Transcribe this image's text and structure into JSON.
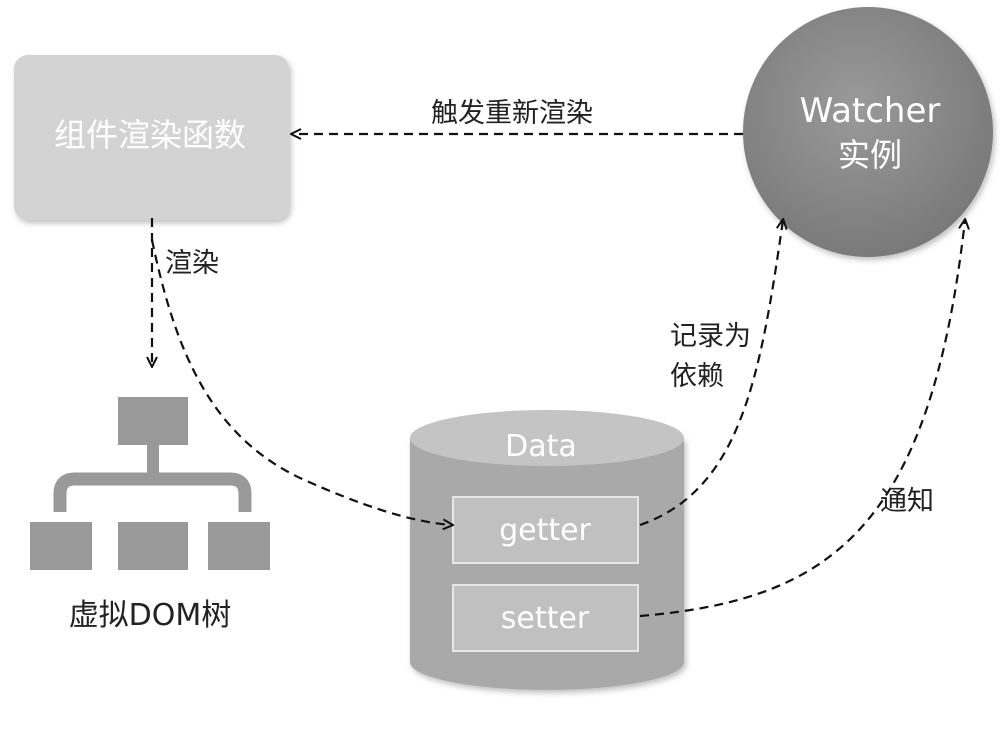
{
  "nodes": {
    "render_function": "组件渲染函数",
    "watcher_line1": "Watcher",
    "watcher_line2": "实例",
    "data_store": "Data",
    "getter": "getter",
    "setter": "setter",
    "vdom_tree": "虚拟DOM树"
  },
  "edges": {
    "trigger_rerender": "触发重新渲染",
    "render": "渲染",
    "record_dependency_line1": "记录为",
    "record_dependency_line2": "依赖",
    "notify": "通知"
  },
  "colors": {
    "box_fill": "#d3d3d3",
    "circle_fill": "#8a8a8a",
    "cylinder_fill": "#a9a9a9",
    "cylinder_top": "#c4c4c4",
    "inner_box_fill": "#c0c0c0",
    "tree_fill": "#999999",
    "light_text": "#ffffff",
    "dark_text": "#222222",
    "arrow": "#111111"
  }
}
